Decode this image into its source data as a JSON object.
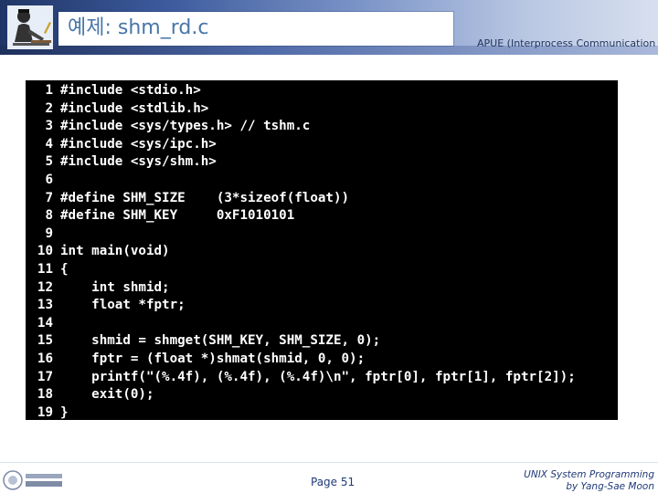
{
  "header": {
    "title": "예제: shm_rd.c",
    "subtitle": "APUE (Interprocess Communication"
  },
  "code": {
    "lines": [
      {
        "num": "1",
        "text": "#include <stdio.h>"
      },
      {
        "num": "2",
        "text": "#include <stdlib.h>"
      },
      {
        "num": "3",
        "text": "#include <sys/types.h> // tshm.c"
      },
      {
        "num": "4",
        "text": "#include <sys/ipc.h>"
      },
      {
        "num": "5",
        "text": "#include <sys/shm.h>"
      },
      {
        "num": "6",
        "text": ""
      },
      {
        "num": "7",
        "text": "#define SHM_SIZE    (3*sizeof(float))"
      },
      {
        "num": "8",
        "text": "#define SHM_KEY     0xF1010101"
      },
      {
        "num": "9",
        "text": ""
      },
      {
        "num": "10",
        "text": "int main(void)"
      },
      {
        "num": "11",
        "text": "{"
      },
      {
        "num": "12",
        "text": "    int shmid;"
      },
      {
        "num": "13",
        "text": "    float *fptr;"
      },
      {
        "num": "14",
        "text": ""
      },
      {
        "num": "15",
        "text": "    shmid = shmget(SHM_KEY, SHM_SIZE, 0);"
      },
      {
        "num": "16",
        "text": "    fptr = (float *)shmat(shmid, 0, 0);"
      },
      {
        "num": "17",
        "text": "    printf(\"(%.4f), (%.4f), (%.4f)\\n\", fptr[0], fptr[1], fptr[2]);"
      },
      {
        "num": "18",
        "text": "    exit(0);"
      },
      {
        "num": "19",
        "text": "}"
      }
    ]
  },
  "footer": {
    "page": "Page 51",
    "right_line1": "UNIX System Programming",
    "right_line2": "by Yang-Sae Moon"
  },
  "icons": {
    "header_logo": "person-at-desk-icon",
    "footer_logo": "university-logo-icon"
  }
}
